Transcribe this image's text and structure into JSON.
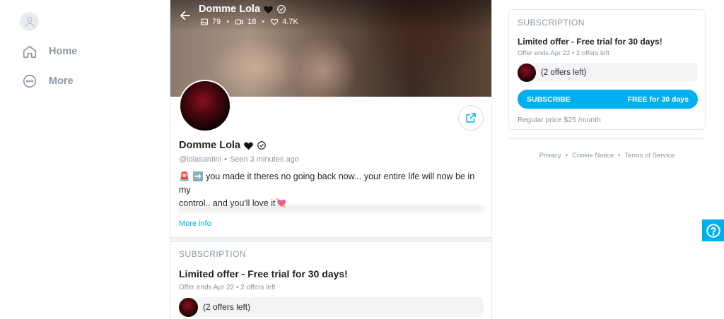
{
  "nav": {
    "items": [
      {
        "label": "Home",
        "icon": "home-icon"
      },
      {
        "label": "More",
        "icon": "more-icon"
      }
    ]
  },
  "profile": {
    "name": "Domme Lola",
    "stats": {
      "photos": "79",
      "videos": "18",
      "likes": "4.7K"
    },
    "username": "@lolasantini",
    "seen": "Seen  3 minutes ago",
    "bio_line1": "🚨 ➡️ you made it theres no going back now... your entire life will now be in my",
    "bio_line2": "control.. and you'll love it💘",
    "more_info": "More info"
  },
  "subscription": {
    "section_title": "SUBSCRIPTION",
    "offer_title": "Limited offer - Free trial for 30 days!",
    "offer_ends": "Offer ends Apr 22",
    "offers_left": "2 offers left",
    "offers_left_paren": "(2 offers left)",
    "button_label": "SUBSCRIBE",
    "button_price": "FREE for 30 days",
    "regular_price": "Regular price $25 /month"
  },
  "footer": {
    "links": [
      "Privacy",
      "Cookie Notice",
      "Terms of Service"
    ]
  },
  "colors": {
    "accent": "#00aff0",
    "muted": "#8a96a3"
  }
}
